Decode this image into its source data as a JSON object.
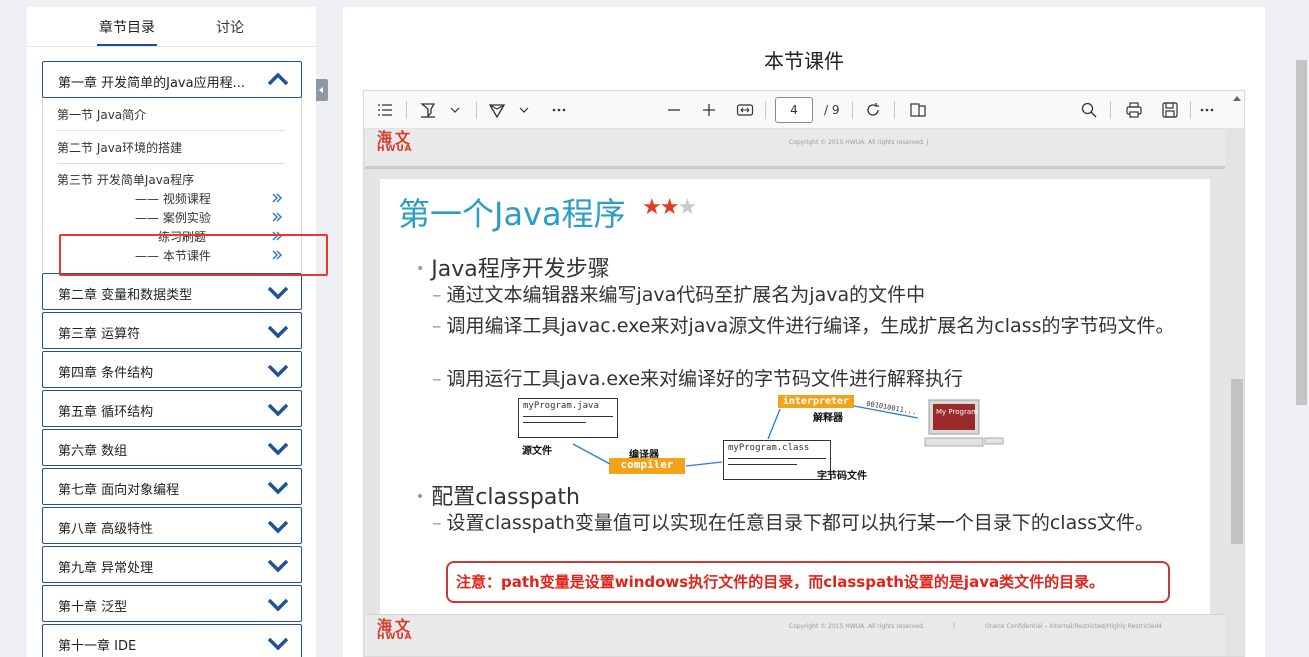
{
  "left": {
    "tabs": [
      "章节目录",
      "讨论"
    ],
    "chapters": [
      {
        "label": "第一章 开发简单的Java应用程...",
        "expanded": true
      },
      {
        "label": "第二章 变量和数据类型"
      },
      {
        "label": "第三章 运算符"
      },
      {
        "label": "第四章 条件结构"
      },
      {
        "label": "第五章 循环结构"
      },
      {
        "label": "第六章 数组"
      },
      {
        "label": "第七章 面向对象编程"
      },
      {
        "label": "第八章 高级特性"
      },
      {
        "label": "第九章 异常处理"
      },
      {
        "label": "第十章 泛型"
      },
      {
        "label": "第十一章 IDE"
      }
    ],
    "sections": [
      "第一节 Java简介",
      "第二节 Java环境的搭建",
      "第三节 开发简单Java程序"
    ],
    "subitems": [
      "—— 视频课程",
      "—— 案例实验",
      "练习刷题",
      "—— 本节课件"
    ]
  },
  "right": {
    "title": "本节课件",
    "toolbar": {
      "page_current": "4",
      "page_total": "/ 9"
    },
    "slide": {
      "logo_cn": "海文",
      "logo_en": "HWUA",
      "copyright": "Copyright © 2015 HWUA. All rights reserved.  |",
      "copyright2": "Copyright © 2015 HWUA. All rights reserved.",
      "confidential": "Oracle Confidential – Internal/Restricted/Highly Restricted4",
      "title": "第一个Java程序",
      "stars": "★★",
      "star_empty": "★",
      "bullet1": "Java程序开发步骤",
      "steps": [
        "通过文本编辑器来编写java代码至扩展名为java的文件中",
        "调用编译工具javac.exe来对java源文件进行编译，生成扩展名为class的字节码文件。",
        "调用运行工具java.exe来对编译好的字节码文件进行解释执行"
      ],
      "bullet2": "配置classpath",
      "step2": "设置classpath变量值可以实现在任意目录下都可以执行某一个目录下的class文件。",
      "note": "注意：path变量是设置windows执行文件的目录，而classpath设置的是java类文件的目录。",
      "dash": "–",
      "diagram": {
        "source_file": "myProgram.java",
        "source_label": "源文件",
        "compiler_label": "编译器",
        "compiler": "compiler",
        "class_file": "myProgram.class",
        "class_label": "字节码文件",
        "interpreter": "interpreter",
        "interpreter_label": "解释器",
        "bits": "001010011...",
        "screen_text": "My Program"
      }
    }
  },
  "colors": {
    "accent": "#1f5394",
    "red": "#e8392c",
    "slide_title": "#2b9dc6"
  }
}
